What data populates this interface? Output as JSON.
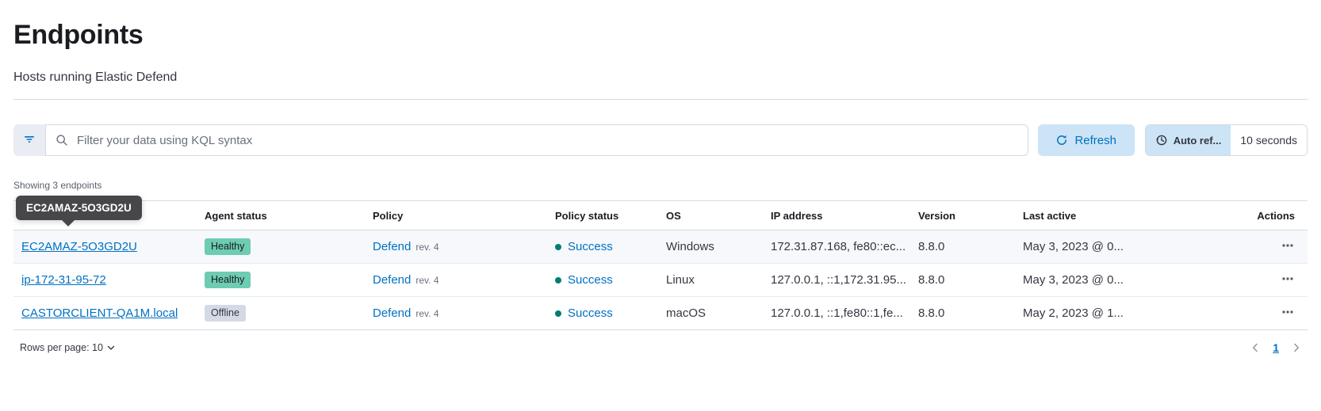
{
  "page": {
    "title": "Endpoints",
    "subtitle": "Hosts running Elastic Defend"
  },
  "toolbar": {
    "search_placeholder": "Filter your data using KQL syntax",
    "refresh_label": "Refresh",
    "auto_refresh_label": "Auto ref...",
    "auto_refresh_value": "10 seconds"
  },
  "summary": "Showing 3 endpoints",
  "tooltip": {
    "text": "EC2AMAZ-5O3GD2U"
  },
  "table": {
    "headers": {
      "endpoint": "",
      "agent_status": "Agent status",
      "policy": "Policy",
      "policy_status": "Policy status",
      "os": "OS",
      "ip": "IP address",
      "version": "Version",
      "last_active": "Last active",
      "actions": "Actions"
    },
    "rows": [
      {
        "endpoint": "EC2AMAZ-5O3GD2U",
        "agent_status": "Healthy",
        "policy": "Defend",
        "policy_rev": "rev. 4",
        "policy_status": "Success",
        "os": "Windows",
        "ip": "172.31.87.168, fe80::ec...",
        "version": "8.8.0",
        "last_active": "May 3, 2023 @ 0..."
      },
      {
        "endpoint": "ip-172-31-95-72",
        "agent_status": "Healthy",
        "policy": "Defend",
        "policy_rev": "rev. 4",
        "policy_status": "Success",
        "os": "Linux",
        "ip": "127.0.0.1, ::1,172.31.95...",
        "version": "8.8.0",
        "last_active": "May 3, 2023 @ 0..."
      },
      {
        "endpoint": "CASTORCLIENT-QA1M.local",
        "agent_status": "Offline",
        "policy": "Defend",
        "policy_rev": "rev. 4",
        "policy_status": "Success",
        "os": "macOS",
        "ip": "127.0.0.1, ::1,fe80::1,fe...",
        "version": "8.8.0",
        "last_active": "May 2, 2023 @ 1..."
      }
    ]
  },
  "footer": {
    "rows_per_page": "Rows per page: 10",
    "current_page": "1"
  },
  "colors": {
    "accent": "#0071c2",
    "healthy_badge": "#6dccb1",
    "offline_badge": "#d3dae6",
    "success_dot": "#017d73",
    "refresh_fill": "#cce4f5"
  }
}
